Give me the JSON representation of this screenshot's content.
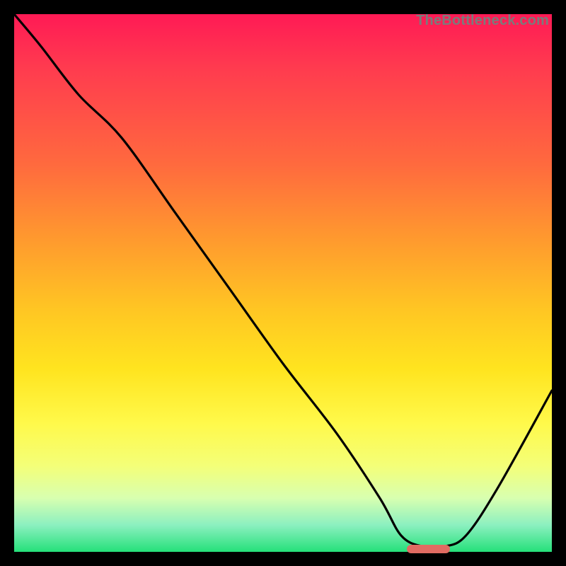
{
  "watermark": "TheBottleneck.com",
  "chart_data": {
    "type": "line",
    "title": "",
    "xlabel": "",
    "ylabel": "",
    "xlim": [
      0,
      100
    ],
    "ylim": [
      0,
      100
    ],
    "legend": false,
    "grid": false,
    "annotations": [
      {
        "kind": "optimum-marker",
        "x_start": 73,
        "x_end": 81,
        "y": 0.5
      }
    ],
    "series": [
      {
        "name": "curve",
        "x": [
          0,
          5,
          12,
          20,
          30,
          40,
          50,
          60,
          68,
          72,
          76,
          80,
          84,
          90,
          100
        ],
        "y": [
          100,
          94,
          85,
          77,
          63,
          49,
          35,
          22,
          10,
          3,
          1,
          1,
          3,
          12,
          30
        ]
      }
    ],
    "background_gradient": {
      "direction": "top-to-bottom",
      "stops": [
        {
          "pos": 0.0,
          "color": "#ff1a55"
        },
        {
          "pos": 0.28,
          "color": "#ff6a3e"
        },
        {
          "pos": 0.55,
          "color": "#ffc623"
        },
        {
          "pos": 0.76,
          "color": "#fff94a"
        },
        {
          "pos": 0.95,
          "color": "#8cf0c0"
        },
        {
          "pos": 1.0,
          "color": "#25e07a"
        }
      ]
    }
  }
}
